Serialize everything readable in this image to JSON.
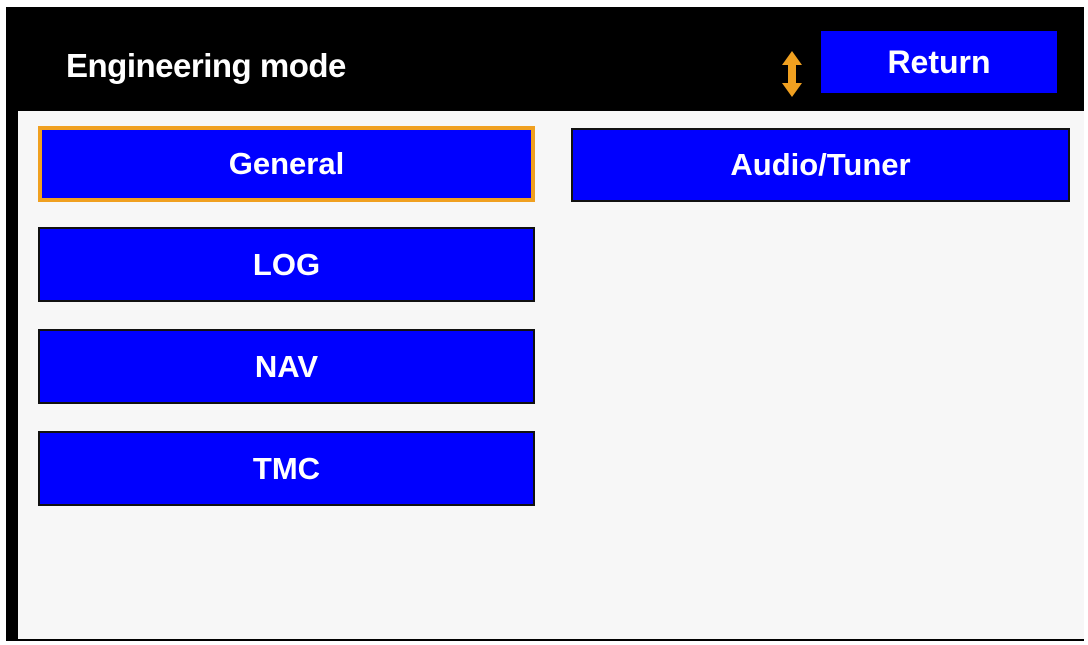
{
  "header": {
    "title": "Engineering mode",
    "return_label": "Return",
    "scroll_icon": "up-down-arrow-icon"
  },
  "menu": {
    "items": [
      {
        "label": "General",
        "selected": true
      },
      {
        "label": "LOG",
        "selected": false
      },
      {
        "label": "NAV",
        "selected": false
      },
      {
        "label": "TMC",
        "selected": false
      },
      {
        "label": "Audio/Tuner",
        "selected": false
      }
    ]
  },
  "colors": {
    "button_blue": "#0000ff",
    "selection_orange": "#f0a020",
    "header_black": "#000000",
    "content_bg": "#f7f7f7"
  }
}
